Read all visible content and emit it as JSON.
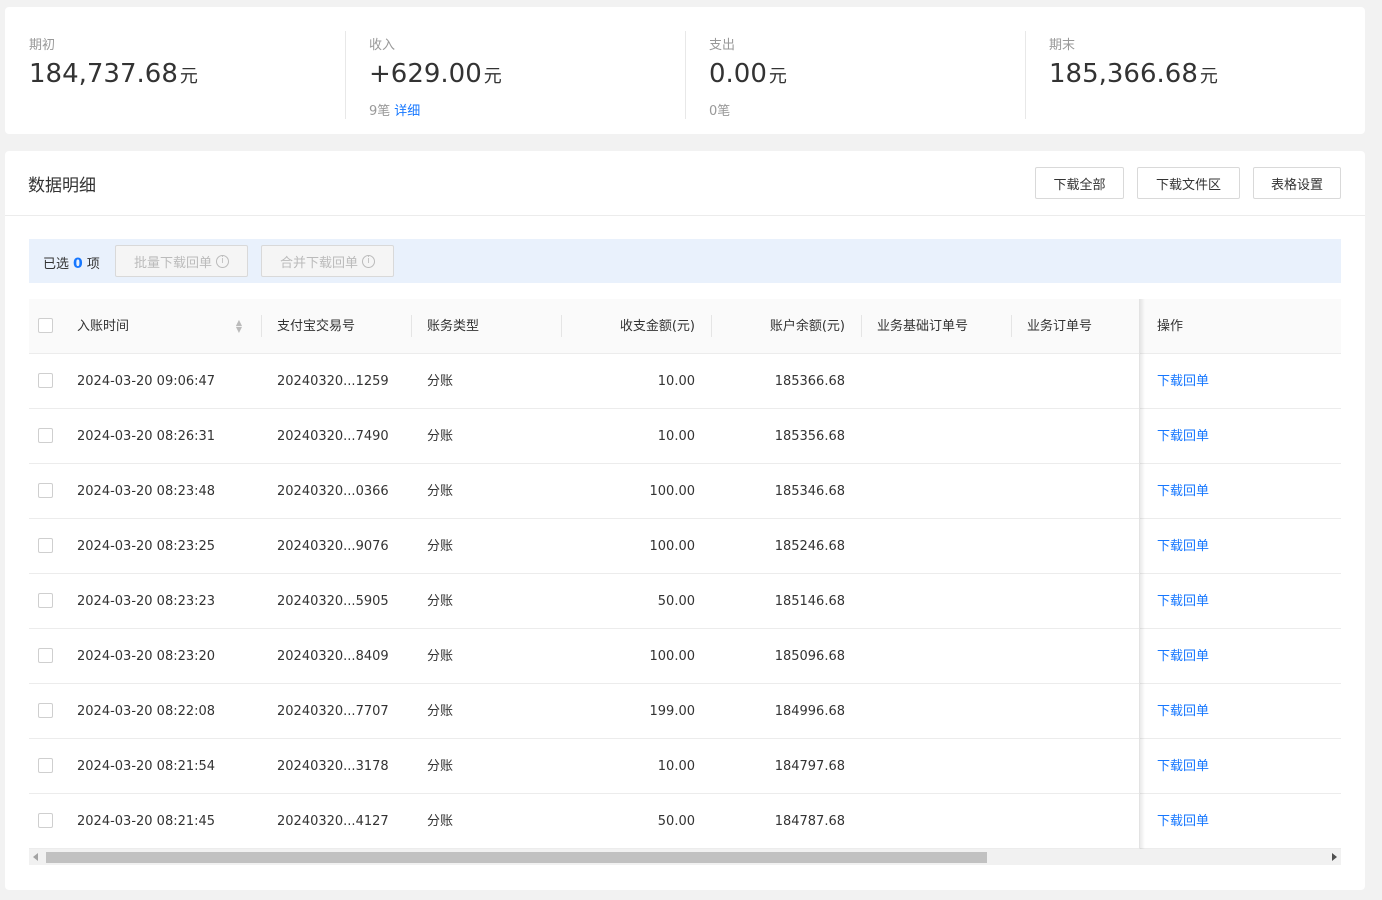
{
  "summary": [
    {
      "label": "期初",
      "amount": "184,737.68",
      "unit": "元",
      "sub_count": "",
      "sub_link": ""
    },
    {
      "label": "收入",
      "amount": "+629.00",
      "unit": "元",
      "sub_count": "9笔",
      "sub_link": "详细"
    },
    {
      "label": "支出",
      "amount": "0.00",
      "unit": "元",
      "sub_count": "0笔",
      "sub_link": ""
    },
    {
      "label": "期末",
      "amount": "185,366.68",
      "unit": "元",
      "sub_count": "",
      "sub_link": ""
    }
  ],
  "details": {
    "title": "数据明细",
    "buttons": {
      "download_all": "下载全部",
      "download_files": "下载文件区",
      "table_settings": "表格设置"
    },
    "selection": {
      "prefix": "已选",
      "count": "0",
      "suffix": "项",
      "batch_download": "批量下载回单",
      "merge_download": "合并下载回单"
    }
  },
  "table": {
    "columns": [
      "入账时间",
      "支付宝交易号",
      "账务类型",
      "收支金额(元)",
      "账户余额(元)",
      "业务基础订单号",
      "业务订单号",
      "操作"
    ],
    "rows": [
      {
        "time": "2024-03-20 09:06:47",
        "trade_no": "20240320...1259",
        "type": "分账",
        "amount": "10.00",
        "balance": "185366.68",
        "base_order": "",
        "order": "",
        "action": "下载回单"
      },
      {
        "time": "2024-03-20 08:26:31",
        "trade_no": "20240320...7490",
        "type": "分账",
        "amount": "10.00",
        "balance": "185356.68",
        "base_order": "",
        "order": "",
        "action": "下载回单"
      },
      {
        "time": "2024-03-20 08:23:48",
        "trade_no": "20240320...0366",
        "type": "分账",
        "amount": "100.00",
        "balance": "185346.68",
        "base_order": "",
        "order": "",
        "action": "下载回单"
      },
      {
        "time": "2024-03-20 08:23:25",
        "trade_no": "20240320...9076",
        "type": "分账",
        "amount": "100.00",
        "balance": "185246.68",
        "base_order": "",
        "order": "",
        "action": "下载回单"
      },
      {
        "time": "2024-03-20 08:23:23",
        "trade_no": "20240320...5905",
        "type": "分账",
        "amount": "50.00",
        "balance": "185146.68",
        "base_order": "",
        "order": "",
        "action": "下载回单"
      },
      {
        "time": "2024-03-20 08:23:20",
        "trade_no": "20240320...8409",
        "type": "分账",
        "amount": "100.00",
        "balance": "185096.68",
        "base_order": "",
        "order": "",
        "action": "下载回单"
      },
      {
        "time": "2024-03-20 08:22:08",
        "trade_no": "20240320...7707",
        "type": "分账",
        "amount": "199.00",
        "balance": "184996.68",
        "base_order": "",
        "order": "",
        "action": "下载回单"
      },
      {
        "time": "2024-03-20 08:21:54",
        "trade_no": "20240320...3178",
        "type": "分账",
        "amount": "10.00",
        "balance": "184797.68",
        "base_order": "",
        "order": "",
        "action": "下载回单"
      },
      {
        "time": "2024-03-20 08:21:45",
        "trade_no": "20240320...4127",
        "type": "分账",
        "amount": "50.00",
        "balance": "184787.68",
        "base_order": "",
        "order": "",
        "action": "下载回单"
      }
    ]
  },
  "scroll": {
    "position_fraction": 0.0
  },
  "colors": {
    "accent": "#1677ff",
    "selection_bar": "#e9f1fc"
  },
  "icons": {
    "info": "info-icon",
    "sort": "sort-icon"
  }
}
